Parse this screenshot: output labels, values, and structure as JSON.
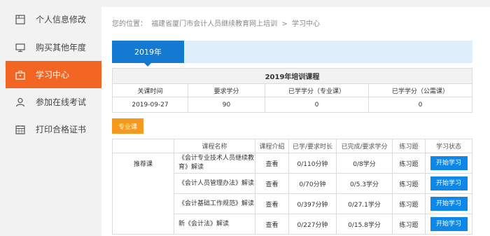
{
  "sidebar": {
    "items": [
      {
        "label": "个人信息修改",
        "icon": "edit-icon",
        "active": false
      },
      {
        "label": "购买其他年度",
        "icon": "monitor-icon",
        "active": false
      },
      {
        "label": "学习中心",
        "icon": "briefcase-icon",
        "active": true
      },
      {
        "label": "参加在线考试",
        "icon": "user-icon",
        "active": false
      },
      {
        "label": "打印合格证书",
        "icon": "calendar-icon",
        "active": false
      }
    ],
    "accent": "#f26522"
  },
  "breadcrumb": {
    "prefix": "您的位置：",
    "path": "福建省厦门市会计人员继续教育网上培训",
    "sep": ">",
    "current": "学习中心"
  },
  "year_tab": "2019年",
  "summary": {
    "caption": "2019年培训课程",
    "headers": [
      "关课时间",
      "要求学分",
      "已学学分（专业课）",
      "已学学分（公需课）"
    ],
    "row": [
      "2019-09-27",
      "90",
      "0",
      "0"
    ]
  },
  "category_button": "专业课",
  "courses": {
    "headers": [
      "",
      "课程名称",
      "课程介绍",
      "已学/要求时长",
      "已完成/要求学分",
      "练习题",
      "学习状态"
    ],
    "group_label": "推荐课",
    "rows": [
      {
        "name": "《会计专业技术人员继续教育》解读",
        "intro": "查看",
        "time": "0/110分钟",
        "credit": "0/8学分",
        "exercise": "练习题",
        "action": "开始学习"
      },
      {
        "name": "《会计人员管理办法》解读",
        "intro": "查看",
        "time": "0/70分钟",
        "credit": "0/5.3学分",
        "exercise": "练习题",
        "action": "开始学习"
      },
      {
        "name": "《会计基础工作规范》解读",
        "intro": "查看",
        "time": "0/397分钟",
        "credit": "0/27.1学分",
        "exercise": "练习题",
        "action": "开始学习"
      },
      {
        "name": "新《会计法》解读",
        "intro": "查看",
        "time": "0/227分钟",
        "credit": "0/15.8学分",
        "exercise": "练习题",
        "action": "开始学习"
      }
    ]
  },
  "colors": {
    "primary_blue": "#1479d0",
    "button_blue": "#0f87e6",
    "orange_tag": "#f59a1f"
  }
}
